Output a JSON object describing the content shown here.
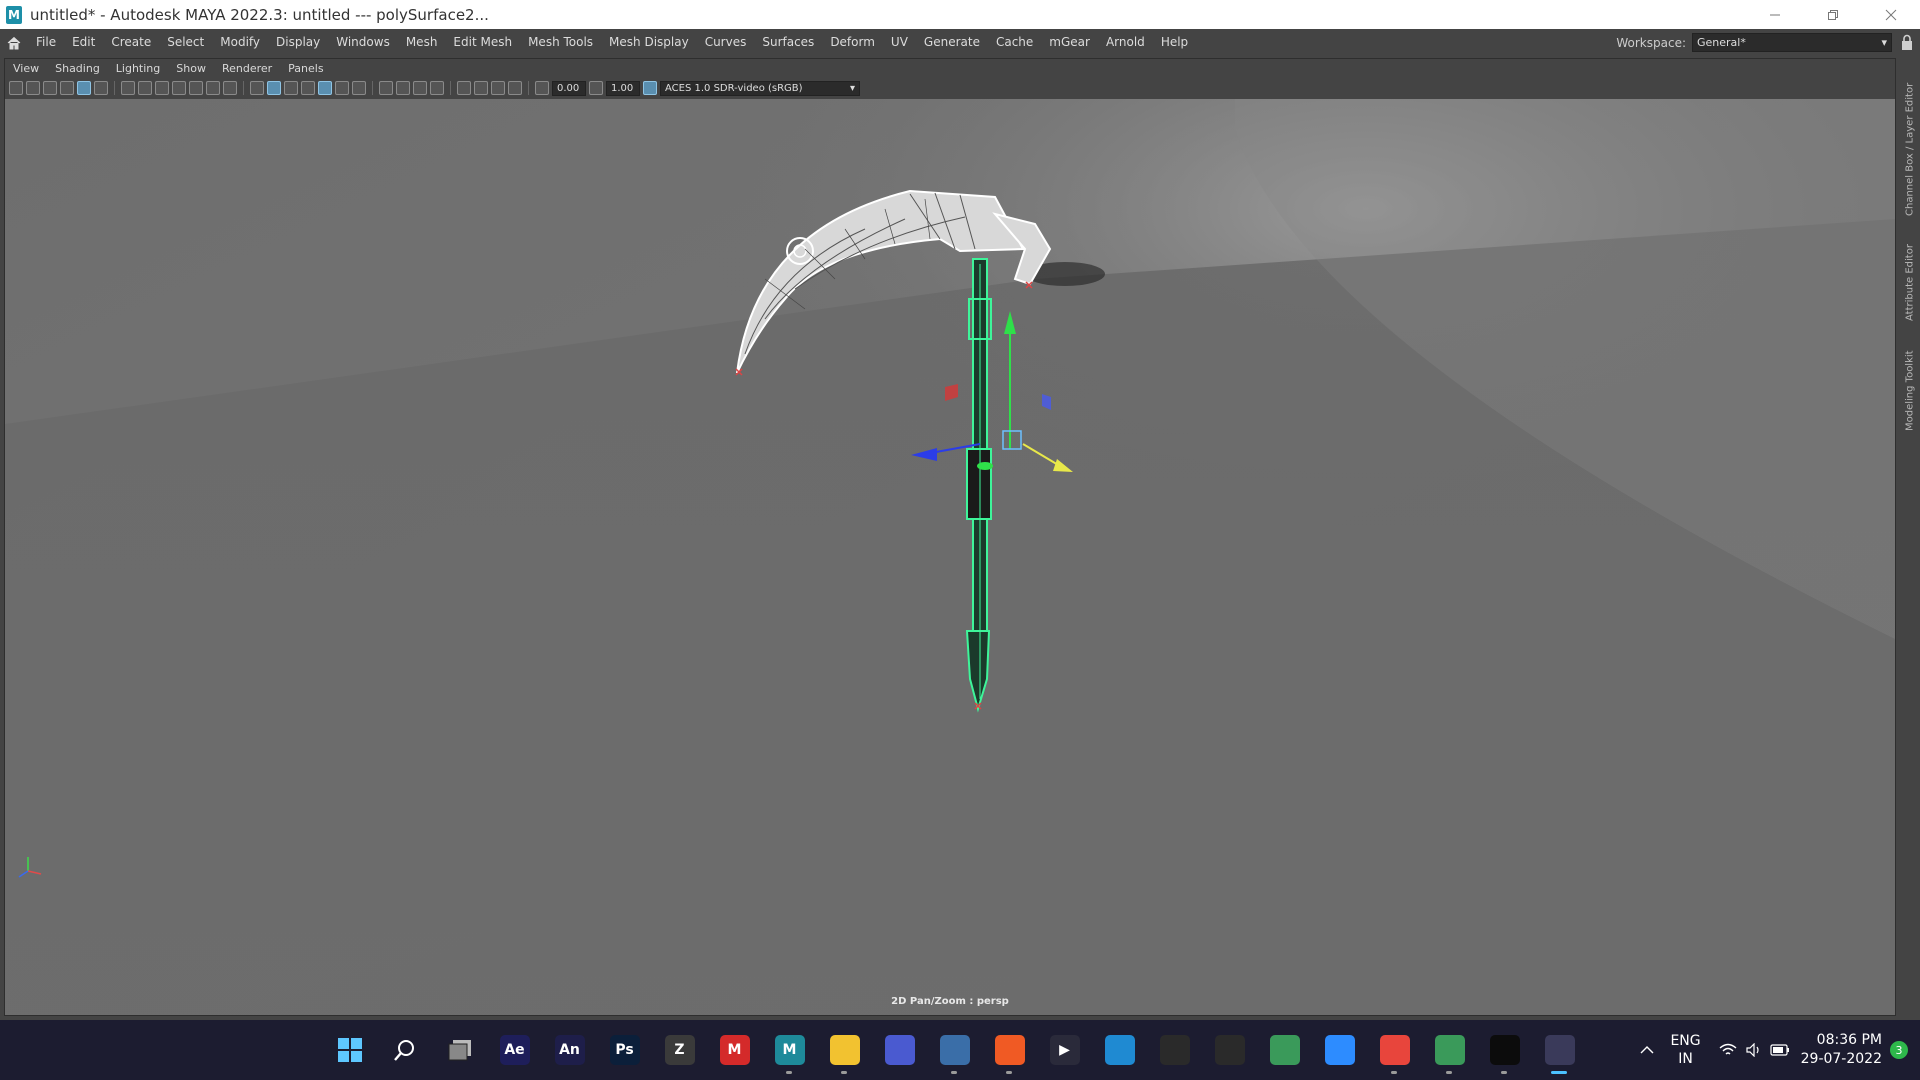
{
  "window": {
    "title": "untitled* - Autodesk MAYA 2022.3: untitled   ---   polySurface2...",
    "app_icon_letter": "M",
    "controls": [
      "minimize-icon",
      "restore-icon",
      "close-icon"
    ]
  },
  "menubar": {
    "home_icon": "home-icon",
    "items": [
      "File",
      "Edit",
      "Create",
      "Select",
      "Modify",
      "Display",
      "Windows",
      "Mesh",
      "Edit Mesh",
      "Mesh Tools",
      "Mesh Display",
      "Curves",
      "Surfaces",
      "Deform",
      "UV",
      "Generate",
      "Cache",
      "mGear",
      "Arnold",
      "Help"
    ],
    "workspace_label": "Workspace:",
    "workspace_value": "General*",
    "lock_icon": "lock-icon"
  },
  "right_tabs": [
    "Channel Box / Layer Editor",
    "Attribute Editor",
    "Modeling Toolkit"
  ],
  "panel": {
    "menu": [
      "View",
      "Shading",
      "Lighting",
      "Show",
      "Renderer",
      "Panels"
    ],
    "toolbar": {
      "exposure_value": "0.00",
      "gamma_value": "1.00",
      "color_space": "ACES 1.0 SDR-video (sRGB)"
    },
    "hud_label": "2D Pan/Zoom : persp"
  },
  "taskbar": {
    "apps": [
      {
        "name": "start",
        "glyph": "",
        "color": "#2aa2f5",
        "running": false,
        "active": false
      },
      {
        "name": "search",
        "glyph": "",
        "color": "transparent",
        "running": false,
        "active": false
      },
      {
        "name": "task-view",
        "glyph": "",
        "color": "transparent",
        "running": false,
        "active": false
      },
      {
        "name": "after-effects",
        "glyph": "Ae",
        "color": "#1e1e5a",
        "running": false,
        "active": false
      },
      {
        "name": "animate",
        "glyph": "An",
        "color": "#1e1e4a",
        "running": false,
        "active": false
      },
      {
        "name": "photoshop",
        "glyph": "Ps",
        "color": "#0b1f3a",
        "running": false,
        "active": false
      },
      {
        "name": "zbrush",
        "glyph": "Z",
        "color": "#3a3a3a",
        "running": false,
        "active": false
      },
      {
        "name": "marmoset",
        "glyph": "M",
        "color": "#d42a2a",
        "running": false,
        "active": false
      },
      {
        "name": "maya",
        "glyph": "M",
        "color": "#1e8a9a",
        "running": true,
        "active": false
      },
      {
        "name": "file-explorer",
        "glyph": "",
        "color": "#f2c230",
        "running": true,
        "active": false
      },
      {
        "name": "whatsapp-web",
        "glyph": "",
        "color": "#4a5ad0",
        "running": false,
        "active": false
      },
      {
        "name": "task-manager",
        "glyph": "",
        "color": "#3a6ea8",
        "running": true,
        "active": false
      },
      {
        "name": "brave",
        "glyph": "",
        "color": "#f05a24",
        "running": true,
        "active": false
      },
      {
        "name": "media-player",
        "glyph": "▶",
        "color": "#2a2a3a",
        "running": false,
        "active": false
      },
      {
        "name": "vs-code",
        "glyph": "",
        "color": "#1f8ad2",
        "running": false,
        "active": false
      },
      {
        "name": "unity-hub",
        "glyph": "",
        "color": "#2a2a2a",
        "running": false,
        "active": false
      },
      {
        "name": "unity",
        "glyph": "",
        "color": "#2a2a2a",
        "running": false,
        "active": false
      },
      {
        "name": "atom",
        "glyph": "",
        "color": "#3a9a5a",
        "running": false,
        "active": false
      },
      {
        "name": "zoom",
        "glyph": "",
        "color": "#2d8cff",
        "running": false,
        "active": false
      },
      {
        "name": "chrome",
        "glyph": "",
        "color": "#e8453c",
        "running": true,
        "active": false
      },
      {
        "name": "atom-2",
        "glyph": "",
        "color": "#3a9a5a",
        "running": true,
        "active": false
      },
      {
        "name": "terminal",
        "glyph": "",
        "color": "#0c0c0c",
        "running": true,
        "active": false
      },
      {
        "name": "snipping-tool",
        "glyph": "",
        "color": "#3a3a5a",
        "running": true,
        "active": true
      }
    ],
    "tray": {
      "lang_line1": "ENG",
      "lang_line2": "IN",
      "time": "08:36 PM",
      "date": "29-07-2022",
      "notifications": "3"
    }
  }
}
